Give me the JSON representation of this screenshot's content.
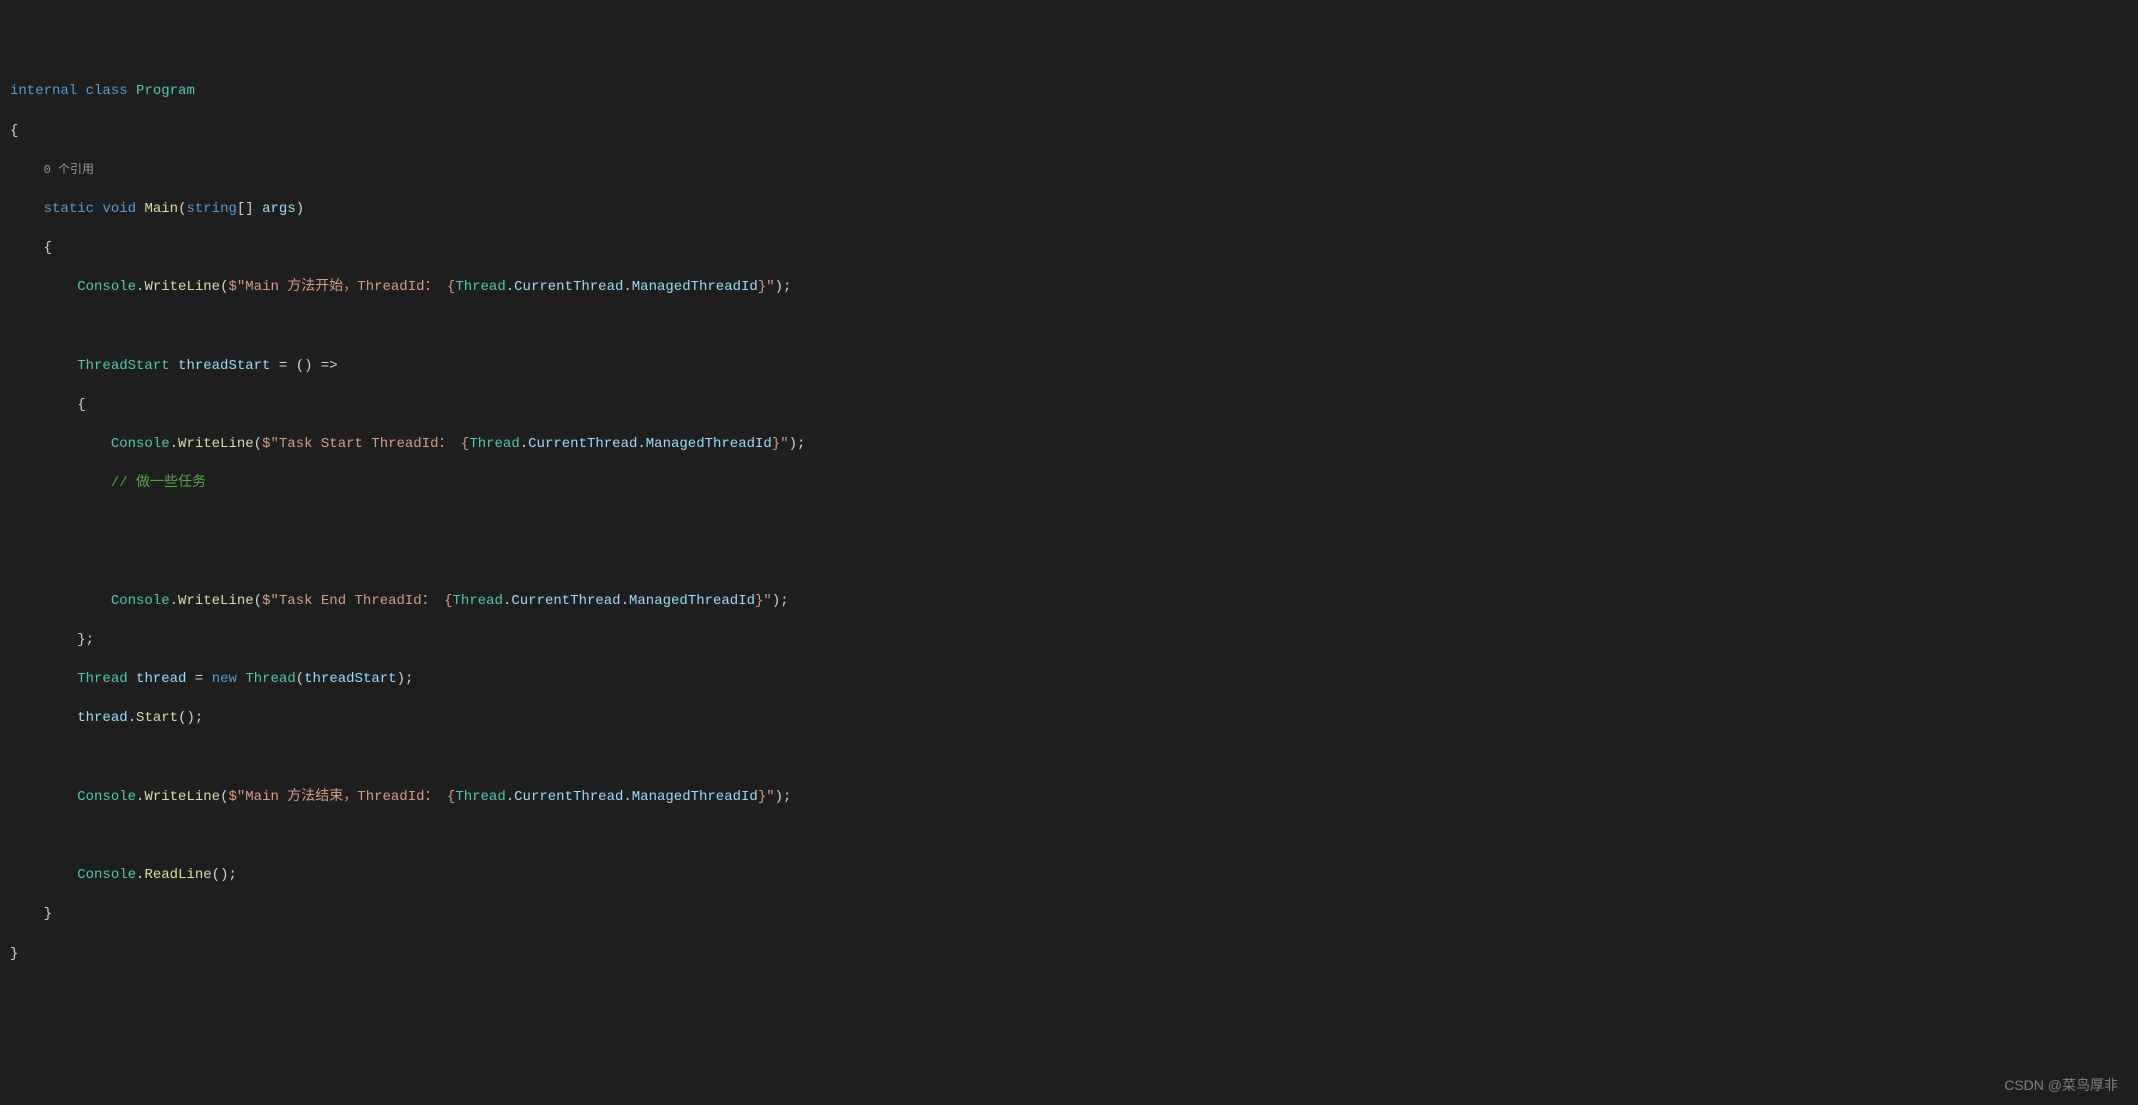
{
  "code": {
    "kw_internal": "internal",
    "kw_class": "class",
    "cls_program": "Program",
    "brace_open": "{",
    "brace_close": "}",
    "codelens_refs": "0 个引用",
    "kw_static": "static",
    "kw_void": "void",
    "method_main": "Main",
    "paren_open": "(",
    "paren_close": ")",
    "kw_string": "string",
    "brackets": "[]",
    "var_args": "args",
    "cls_console": "Console",
    "dot": ".",
    "method_writeline": "WriteLine",
    "dollar": "$",
    "str_main_start_prefix": "\"Main ",
    "str_main_start_cn": "方法开始，",
    "str_threadid_label": "ThreadId：",
    "str_space_brace": " {",
    "cls_thread": "Thread",
    "prop_currentthread": "CurrentThread",
    "prop_managedthreadid": "ManagedThreadId",
    "str_close_interp": "}\"",
    "semicolon": ";",
    "cls_threadstart": "ThreadStart",
    "var_threadstart": "threadStart",
    "equals": " = ",
    "lambda": "() =>",
    "str_task_start": "\"Task Start ThreadId：",
    "comment_task": "// 做一些任务",
    "str_task_end": "\"Task End ThreadId：",
    "var_thread": "thread",
    "kw_new": "new",
    "method_start": "Start",
    "str_main_end_prefix": "\"Main ",
    "str_main_end_cn": "方法结束，",
    "method_readline": "ReadLine"
  },
  "watermark": "CSDN @菜鸟厚非"
}
